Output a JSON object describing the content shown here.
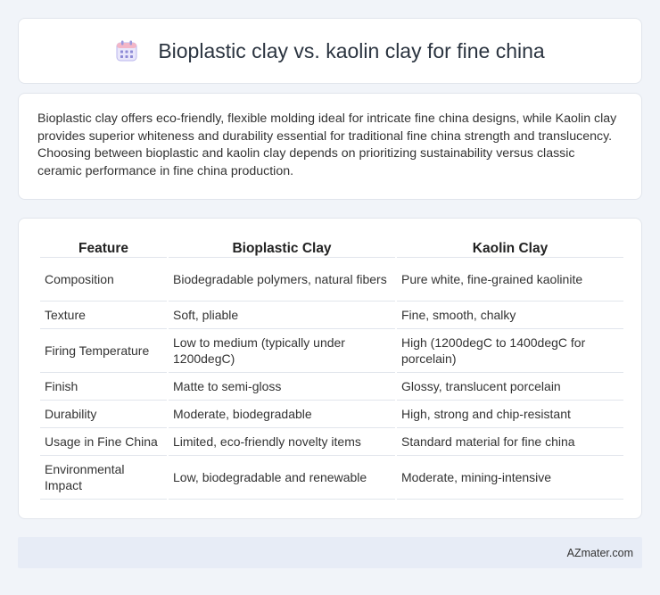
{
  "header": {
    "title": "Bioplastic clay vs. kaolin clay for fine china",
    "icon": "calendar-icon"
  },
  "summary": {
    "text": "Bioplastic clay offers eco-friendly, flexible molding ideal for intricate fine china designs, while Kaolin clay provides superior whiteness and durability essential for traditional fine china strength and translucency. Choosing between bioplastic and kaolin clay depends on prioritizing sustainability versus classic ceramic performance in fine china production."
  },
  "table": {
    "headers": [
      "Feature",
      "Bioplastic Clay",
      "Kaolin Clay"
    ],
    "rows": [
      [
        "Composition",
        "Biodegradable polymers, natural fibers",
        "Pure white, fine-grained kaolinite"
      ],
      [
        "Texture",
        "Soft, pliable",
        "Fine, smooth, chalky"
      ],
      [
        "Firing Temperature",
        "Low to medium (typically under 1200degC)",
        "High (1200degC to 1400degC for porcelain)"
      ],
      [
        "Finish",
        "Matte to semi-gloss",
        "Glossy, translucent porcelain"
      ],
      [
        "Durability",
        "Moderate, biodegradable",
        "High, strong and chip-resistant"
      ],
      [
        "Usage in Fine China",
        "Limited, eco-friendly novelty items",
        "Standard material for fine china"
      ],
      [
        "Environmental Impact",
        "Low, biodegradable and renewable",
        "Moderate, mining-intensive"
      ]
    ]
  },
  "footer": {
    "text": "AZmater.com"
  },
  "colors": {
    "background": "#f1f4f9",
    "card": "#ffffff",
    "footer": "#e7ecf6",
    "icon_accent": "#8e8bd6"
  }
}
